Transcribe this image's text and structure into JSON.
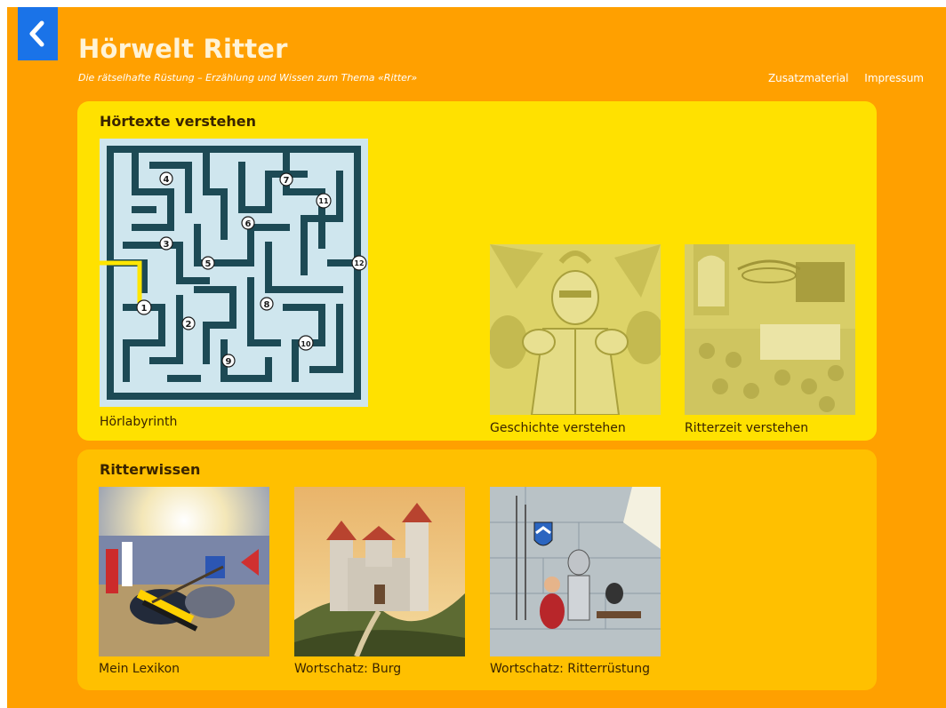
{
  "header": {
    "back_label": "‹",
    "title": "Hörwelt Ritter",
    "subtitle": "Die rätselhafte Rüstung – Erzählung und Wissen zum Thema «Ritter»",
    "nav": [
      "Zusatzmaterial",
      "Impressum"
    ]
  },
  "sections": [
    {
      "title": "Hörtexte verstehen",
      "tiles": [
        {
          "label": "Hörlabyrinth",
          "icon": "maze-image"
        },
        {
          "label": "Geschichte verstehen",
          "icon": "knight-armor-image"
        },
        {
          "label": "Ritterzeit verstehen",
          "icon": "banquet-hall-image"
        }
      ]
    },
    {
      "title": "Ritterwissen",
      "tiles": [
        {
          "label": "Mein Lexikon",
          "icon": "joust-image"
        },
        {
          "label": "Wortschatz: Burg",
          "icon": "castle-image"
        },
        {
          "label": "Wortschatz: Ritterrüstung",
          "icon": "armor-room-image"
        }
      ]
    }
  ],
  "maze_numbers": [
    "1",
    "2",
    "3",
    "4",
    "5",
    "6",
    "7",
    "8",
    "9",
    "10",
    "11",
    "12"
  ],
  "colors": {
    "background": "#ffa000",
    "panel_primary": "#ffe100",
    "panel_secondary": "#ffc000",
    "back_button": "#1a73e8"
  }
}
